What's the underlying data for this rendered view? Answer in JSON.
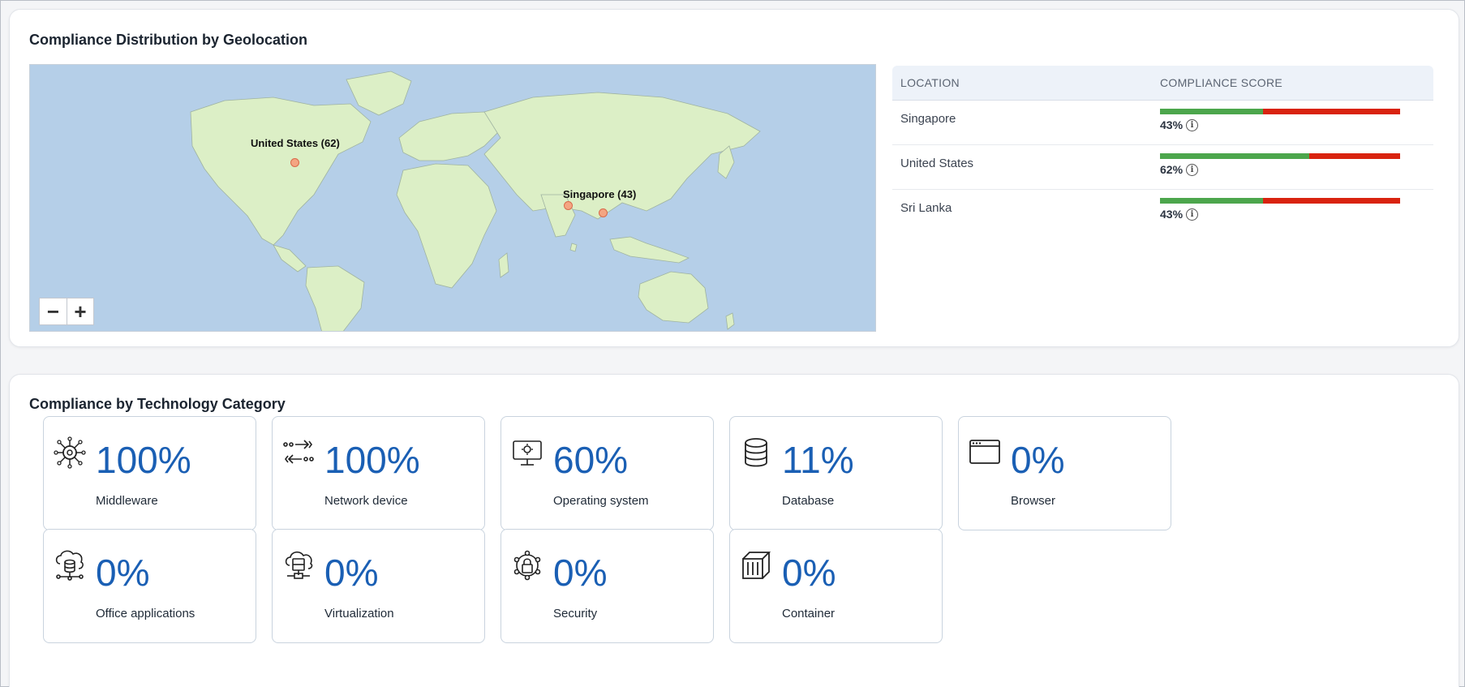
{
  "geo_section": {
    "title": "Compliance Distribution by Geolocation",
    "map": {
      "markers": [
        {
          "label": "United States (62)"
        },
        {
          "label": "Singapore (43)"
        }
      ],
      "zoom_out": "−",
      "zoom_in": "+",
      "colors": {
        "ocean": "#b5cfe8",
        "land": "#dcefc6",
        "marker": "#f4a582"
      }
    },
    "table": {
      "headers": [
        "LOCATION",
        "COMPLIANCE SCORE"
      ],
      "rows": [
        {
          "location": "Singapore",
          "score": "43%",
          "fraction": 0.43
        },
        {
          "location": "United States",
          "score": "62%",
          "fraction": 0.62
        },
        {
          "location": "Sri Lanka",
          "score": "43%",
          "fraction": 0.43
        }
      ],
      "colors": {
        "pass": "#4ca64c",
        "fail": "#d9230f"
      }
    }
  },
  "tech_section": {
    "title": "Compliance by Technology Category",
    "tiles": [
      {
        "icon": "middleware-icon",
        "percent": "100%",
        "label": "Middleware"
      },
      {
        "icon": "network-device-icon",
        "percent": "100%",
        "label": "Network device"
      },
      {
        "icon": "operating-system-icon",
        "percent": "60%",
        "label": "Operating system"
      },
      {
        "icon": "database-icon",
        "percent": "11%",
        "label": "Database"
      },
      {
        "icon": "browser-icon",
        "percent": "0%",
        "label": "Browser"
      },
      {
        "icon": "office-applications-icon",
        "percent": "0%",
        "label": "Office applications"
      },
      {
        "icon": "virtualization-icon",
        "percent": "0%",
        "label": "Virtualization"
      },
      {
        "icon": "security-icon",
        "percent": "0%",
        "label": "Security"
      },
      {
        "icon": "container-icon",
        "percent": "0%",
        "label": "Container"
      }
    ]
  }
}
